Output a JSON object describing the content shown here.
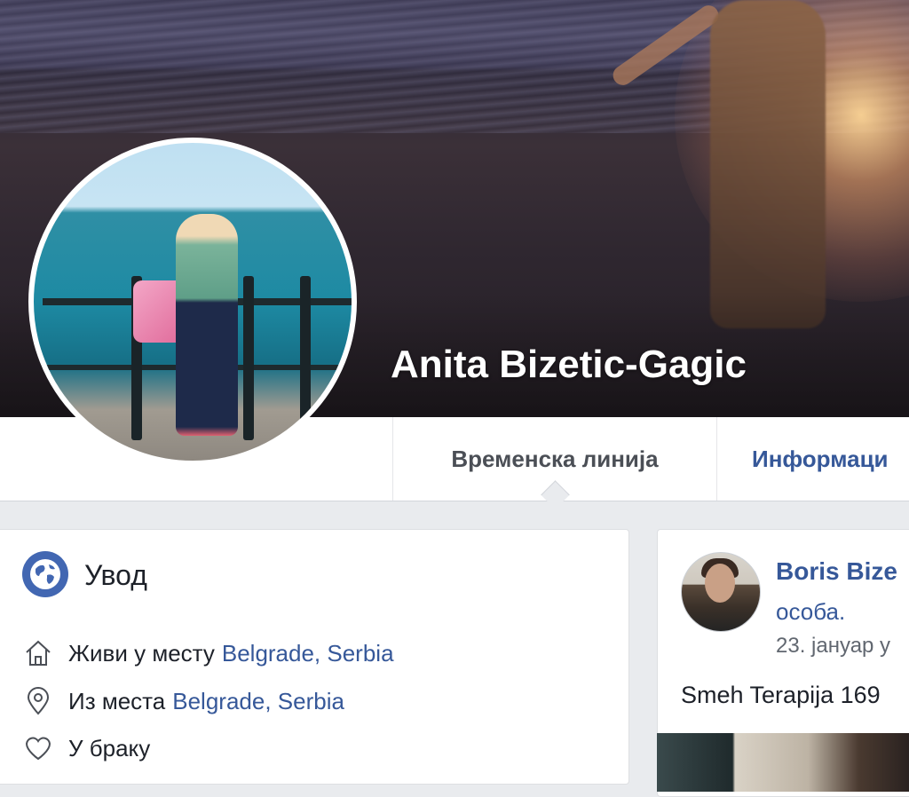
{
  "profile": {
    "name": "Anita Bizetic-Gagic"
  },
  "tabs": [
    {
      "label": "Временска линија",
      "active": true
    },
    {
      "label": "Информаци"
    }
  ],
  "intro": {
    "title": "Увод",
    "lives_label": "Живи у месту",
    "lives_place": "Belgrade, Serbia",
    "from_label": "Из места",
    "from_place": "Belgrade, Serbia",
    "relationship": "У браку"
  },
  "post": {
    "author": "Boris Bize",
    "subtitle": "особа.",
    "date": "23. јануар у",
    "text": "Smeh Terapija 169"
  },
  "colors": {
    "link": "#365899",
    "accent": "#4267b2",
    "text": "#1d2129"
  }
}
